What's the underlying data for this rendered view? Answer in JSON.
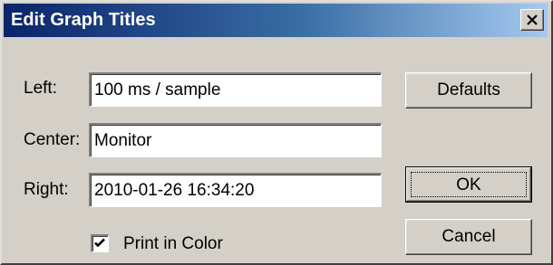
{
  "window": {
    "title": "Edit Graph Titles"
  },
  "fields": {
    "left_label": "Left:",
    "left_value": "100 ms / sample",
    "center_label": "Center:",
    "center_value": "Monitor",
    "right_label": "Right:",
    "right_value": "2010-01-26 16:34:20"
  },
  "buttons": {
    "defaults": "Defaults",
    "ok": "OK",
    "cancel": "Cancel"
  },
  "options": {
    "print_in_color_label": "Print in Color",
    "print_in_color_checked": true
  },
  "icons": {
    "close": "close-icon",
    "check": "checkmark-icon"
  },
  "colors": {
    "title_gradient_start": "#0a246a",
    "title_gradient_end": "#a6caf0",
    "dialog_face": "#d4d0c8"
  }
}
